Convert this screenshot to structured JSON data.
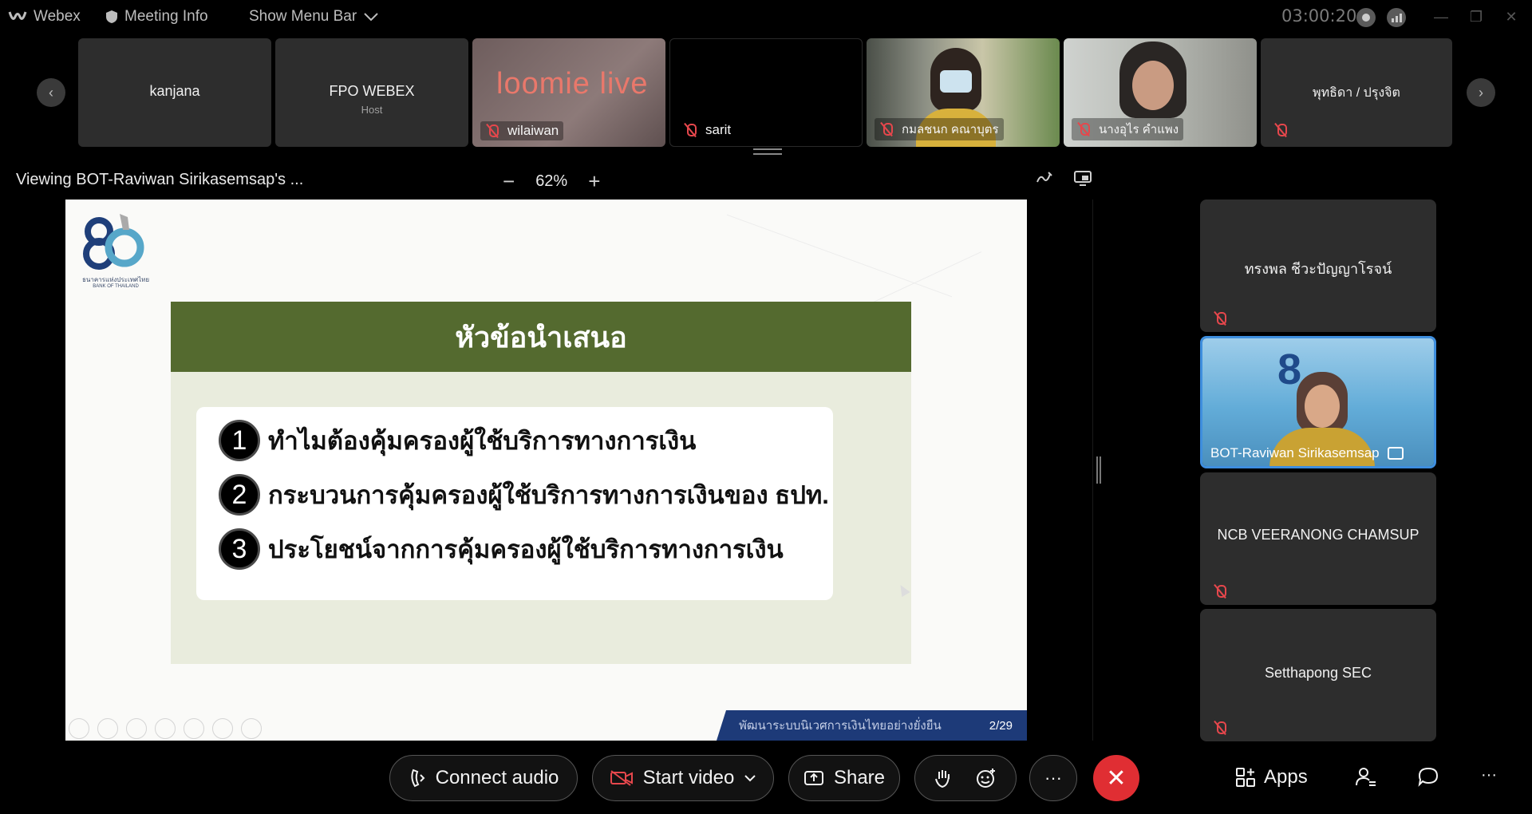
{
  "titlebar": {
    "app_name": "Webex",
    "meeting_info": "Meeting Info",
    "show_menu_bar": "Show Menu Bar",
    "timer": "03:00:20",
    "minimize": "—",
    "restore": "❐",
    "close": "✕"
  },
  "strip": {
    "prev": "‹",
    "next": "›",
    "tiles": [
      {
        "name": "kanjana"
      },
      {
        "name": "FPO WEBEX",
        "role": "Host"
      },
      {
        "name": "wilaiwan",
        "video_text": "loomie live"
      },
      {
        "name": "sarit"
      },
      {
        "name": "กมลชนก คณาบุตร"
      },
      {
        "name": "นางอุไร คำแพง"
      },
      {
        "name": "พุทธิดา / ปรุงจิต"
      }
    ]
  },
  "share_header": {
    "viewing": "Viewing BOT-Raviwan Sirikasemsap's ...",
    "zoom_out": "−",
    "zoom_level": "62%",
    "zoom_in": "+"
  },
  "slide": {
    "logo_number": "80",
    "logo_caption_th": "ธนาคารแห่งประเทศไทย",
    "logo_caption_en": "BANK OF THAILAND",
    "heading": "หัวข้อนำเสนอ",
    "items": [
      {
        "num": "1",
        "text": "ทำไมต้องคุ้มครองผู้ใช้บริการทางการเงิน"
      },
      {
        "num": "2",
        "text": "กระบวนการคุ้มครองผู้ใช้บริการทางการเงินของ ธปท."
      },
      {
        "num": "3",
        "text": "ประโยชน์จากการคุ้มครองผู้ใช้บริการทางการเงิน"
      }
    ],
    "footer_text": "พัฒนาระบบนิเวศการเงินไทยอย่างยั่งยืน",
    "page": "2/29"
  },
  "right_panel": [
    {
      "name": "ทรงพล ชีวะปัญญาโรจน์"
    },
    {
      "name": "BOT-Raviwan Sirikasemsap",
      "video_logo": "8"
    },
    {
      "name": "NCB VEERANONG CHAMSUP"
    },
    {
      "name": "Setthapong SEC"
    }
  ],
  "controls": {
    "connect_audio": "Connect audio",
    "start_video": "Start video",
    "share": "Share",
    "more": "···",
    "end": "✕",
    "apps": "Apps",
    "overflow": "···"
  },
  "colors": {
    "slide_green": "#546a2f",
    "slide_footer_blue": "#1d3a78",
    "end_call_red": "#e02e33",
    "active_speaker_blue": "#3e8ede",
    "muted_red": "#e6474c"
  }
}
